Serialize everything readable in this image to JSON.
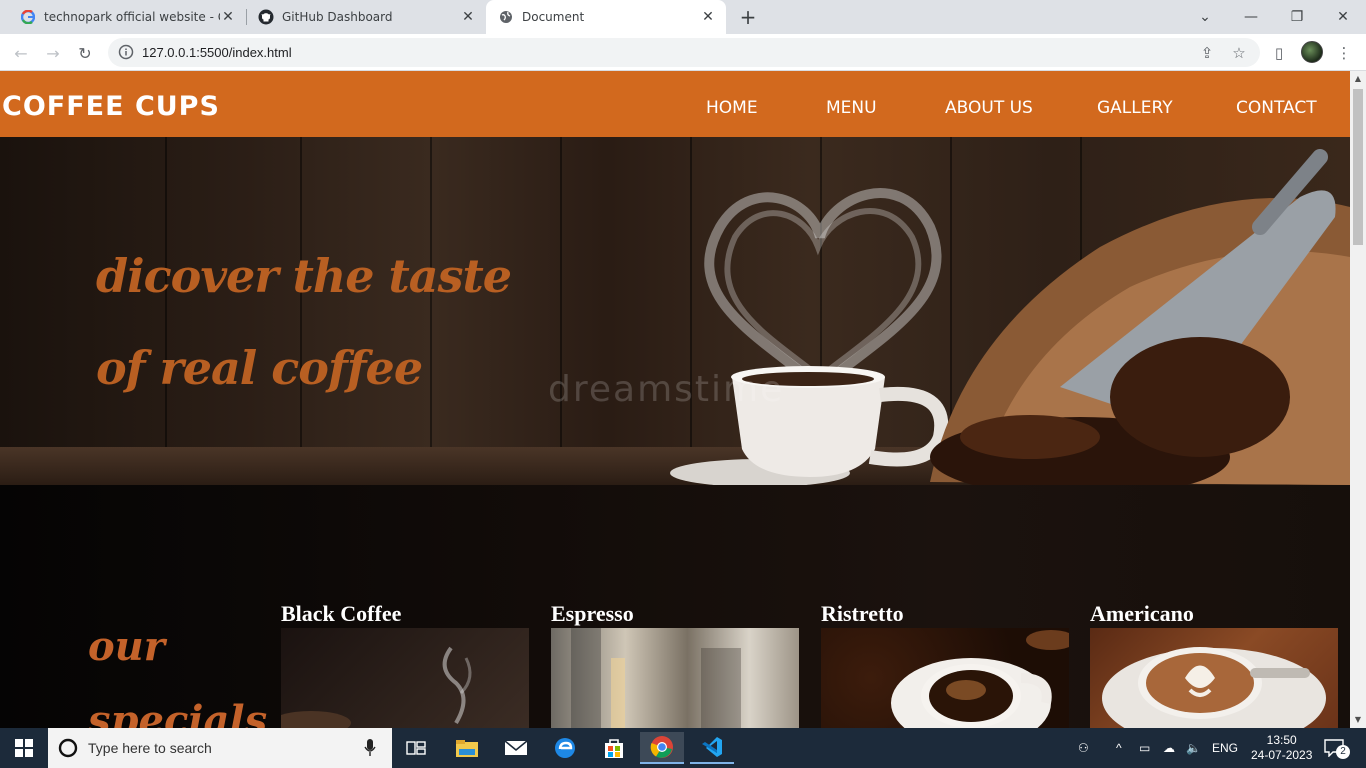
{
  "browser": {
    "tabs": [
      {
        "title": "technopark official website - Goo",
        "close": "✕"
      },
      {
        "title": "GitHub Dashboard",
        "close": "✕"
      },
      {
        "title": "Document",
        "close": "✕"
      }
    ],
    "new_tab": "+",
    "url": "127.0.0.1:5500/index.html",
    "window_controls": {
      "minimize": "—",
      "restore": "❐",
      "close": "✕",
      "tab_search": "⌄"
    }
  },
  "site": {
    "brand": "COFFEE CUPS",
    "nav": [
      "HOME",
      "MENU",
      "ABOUT US",
      "GALLERY",
      "CONTACT"
    ],
    "hero": {
      "line1": "dicover the taste",
      "line2": "of real coffee",
      "watermark": "dreamstime"
    },
    "specials": {
      "title_line1": "our",
      "title_line2": "specials",
      "items": [
        "Black Coffee",
        "Espresso",
        "Ristretto",
        "Americano"
      ]
    },
    "colors": {
      "header": "#d2691e",
      "accent_text": "#b85f22"
    }
  },
  "taskbar": {
    "search_placeholder": "Type here to search",
    "lang": "ENG",
    "time": "13:50",
    "date": "24-07-2023",
    "notifications": "2"
  }
}
